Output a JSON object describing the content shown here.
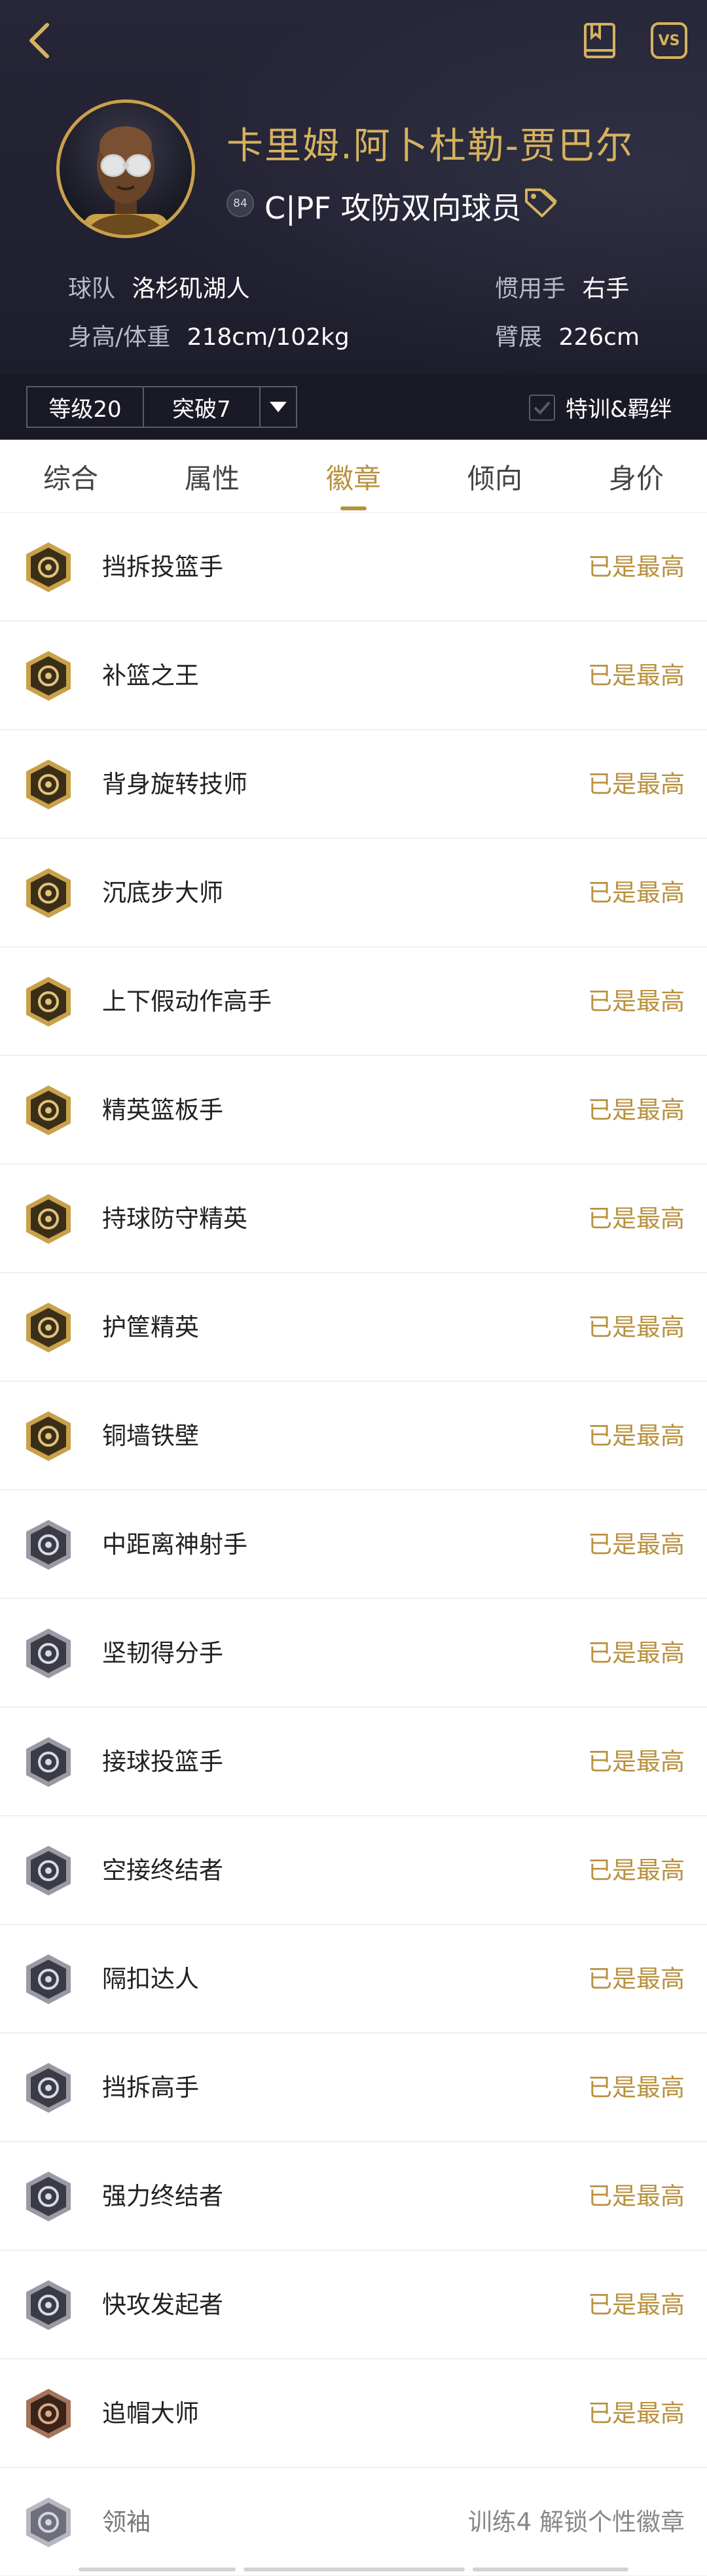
{
  "header": {
    "back_icon": "chevron-left-icon",
    "book_icon": "book-icon",
    "vs_label": "VS",
    "player_name": "卡里姆.阿卜杜勒-贾巴尔",
    "rating": "84",
    "position_line": "C|PF 攻防双向球员",
    "tag_icon": "tag-icon",
    "team_label": "球队",
    "team_value": "洛杉矶湖人",
    "hand_label": "惯用手",
    "hand_value": "右手",
    "height_label": "身高/体重",
    "height_value": "218cm/102kg",
    "wingspan_label": "臂展",
    "wingspan_value": "226cm",
    "accent_color": "#c9a14a"
  },
  "level_bar": {
    "level": "等级20",
    "breakthrough": "突破7",
    "training": "特训&羁绊"
  },
  "tabs": [
    {
      "label": "综合",
      "active": false
    },
    {
      "label": "属性",
      "active": false
    },
    {
      "label": "徽章",
      "active": true
    },
    {
      "label": "倾向",
      "active": false
    },
    {
      "label": "身价",
      "active": false
    }
  ],
  "badges": [
    {
      "name": "挡拆投篮手",
      "status": "已是最高",
      "tier": "gold",
      "icon": "pick-and-pop-icon"
    },
    {
      "name": "补篮之王",
      "status": "已是最高",
      "tier": "gold",
      "icon": "putback-icon"
    },
    {
      "name": "背身旋转技师",
      "status": "已是最高",
      "tier": "gold",
      "icon": "post-spin-icon"
    },
    {
      "name": "沉底步大师",
      "status": "已是最高",
      "tier": "gold",
      "icon": "drop-step-icon"
    },
    {
      "name": "上下假动作高手",
      "status": "已是最高",
      "tier": "gold",
      "icon": "up-and-under-icon"
    },
    {
      "name": "精英篮板手",
      "status": "已是最高",
      "tier": "gold",
      "icon": "rebound-icon"
    },
    {
      "name": "持球防守精英",
      "status": "已是最高",
      "tier": "gold",
      "icon": "ball-defense-icon"
    },
    {
      "name": "护筐精英",
      "status": "已是最高",
      "tier": "gold",
      "icon": "rim-protector-icon"
    },
    {
      "name": "铜墙铁壁",
      "status": "已是最高",
      "tier": "gold",
      "icon": "brick-wall-icon"
    },
    {
      "name": "中距离神射手",
      "status": "已是最高",
      "tier": "silver",
      "icon": "midrange-icon"
    },
    {
      "name": "坚韧得分手",
      "status": "已是最高",
      "tier": "silver",
      "icon": "tough-shot-icon"
    },
    {
      "name": "接球投篮手",
      "status": "已是最高",
      "tier": "silver",
      "icon": "catch-shoot-icon"
    },
    {
      "name": "空接终结者",
      "status": "已是最高",
      "tier": "silver",
      "icon": "lob-finisher-icon"
    },
    {
      "name": "隔扣达人",
      "status": "已是最高",
      "tier": "silver",
      "icon": "dunk-icon"
    },
    {
      "name": "挡拆高手",
      "status": "已是最高",
      "tier": "silver",
      "icon": "screener-icon"
    },
    {
      "name": "强力终结者",
      "status": "已是最高",
      "tier": "silver",
      "icon": "power-finisher-icon"
    },
    {
      "name": "快攻发起者",
      "status": "已是最高",
      "tier": "silver",
      "icon": "fastbreak-icon"
    },
    {
      "name": "追帽大师",
      "status": "已是最高",
      "tier": "bronze",
      "icon": "chase-block-icon"
    },
    {
      "name": "领袖",
      "status": "训练4 解锁个性徽章",
      "tier": "locked",
      "icon": "crown-icon"
    }
  ],
  "colors": {
    "gold_text": "#b8913f",
    "header_bg": "#202030"
  }
}
